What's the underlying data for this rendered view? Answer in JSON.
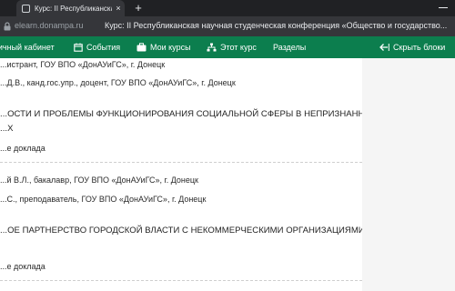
{
  "browser": {
    "tab_title": "Курс: II Республиканская",
    "tab_close": "×",
    "new_tab": "+",
    "url_host": "elearn.donampa.ru",
    "page_title": "Курс: II Республиканская научная студенческая конференция «Общество и государство..."
  },
  "navbar": {
    "items": [
      {
        "label": "Личный кабинет"
      },
      {
        "label": "События"
      },
      {
        "label": "Мои курсы"
      },
      {
        "label": "Этот курс"
      },
      {
        "label": "Разделы"
      },
      {
        "label": "Скрыть блоки"
      }
    ]
  },
  "content": {
    "lines": [
      "...истрант, ГОУ ВПО «ДонАУиГС», г. Донецк",
      "...Д.В., канд.гос.упр., доцент, ГОУ ВПО «ДонАУиГС», г. Донецк",
      "...ОСТИ И ПРОБЛЕМЫ ФУНКЦИОНИРОВАНИЯ СОЦИАЛЬНОЙ СФЕРЫ В НЕПРИЗНАННЫХ",
      "...Х",
      "...е доклада",
      "...й В.Л., бакалавр, ГОУ ВПО «ДонАУиГС», г. Донецк",
      "...С., преподаватель, ГОУ ВПО «ДонАУиГС», г. Донецк",
      "...ОЕ ПАРТНЕРСТВО ГОРОДСКОЙ ВЛАСТИ С НЕКОММЕРЧЕСКИМИ ОРГАНИЗАЦИЯМИ",
      "...е доклада"
    ]
  },
  "colors": {
    "navbar": "#0c7e4e",
    "browser_dark": "#202124",
    "toolbar": "#35363a"
  }
}
